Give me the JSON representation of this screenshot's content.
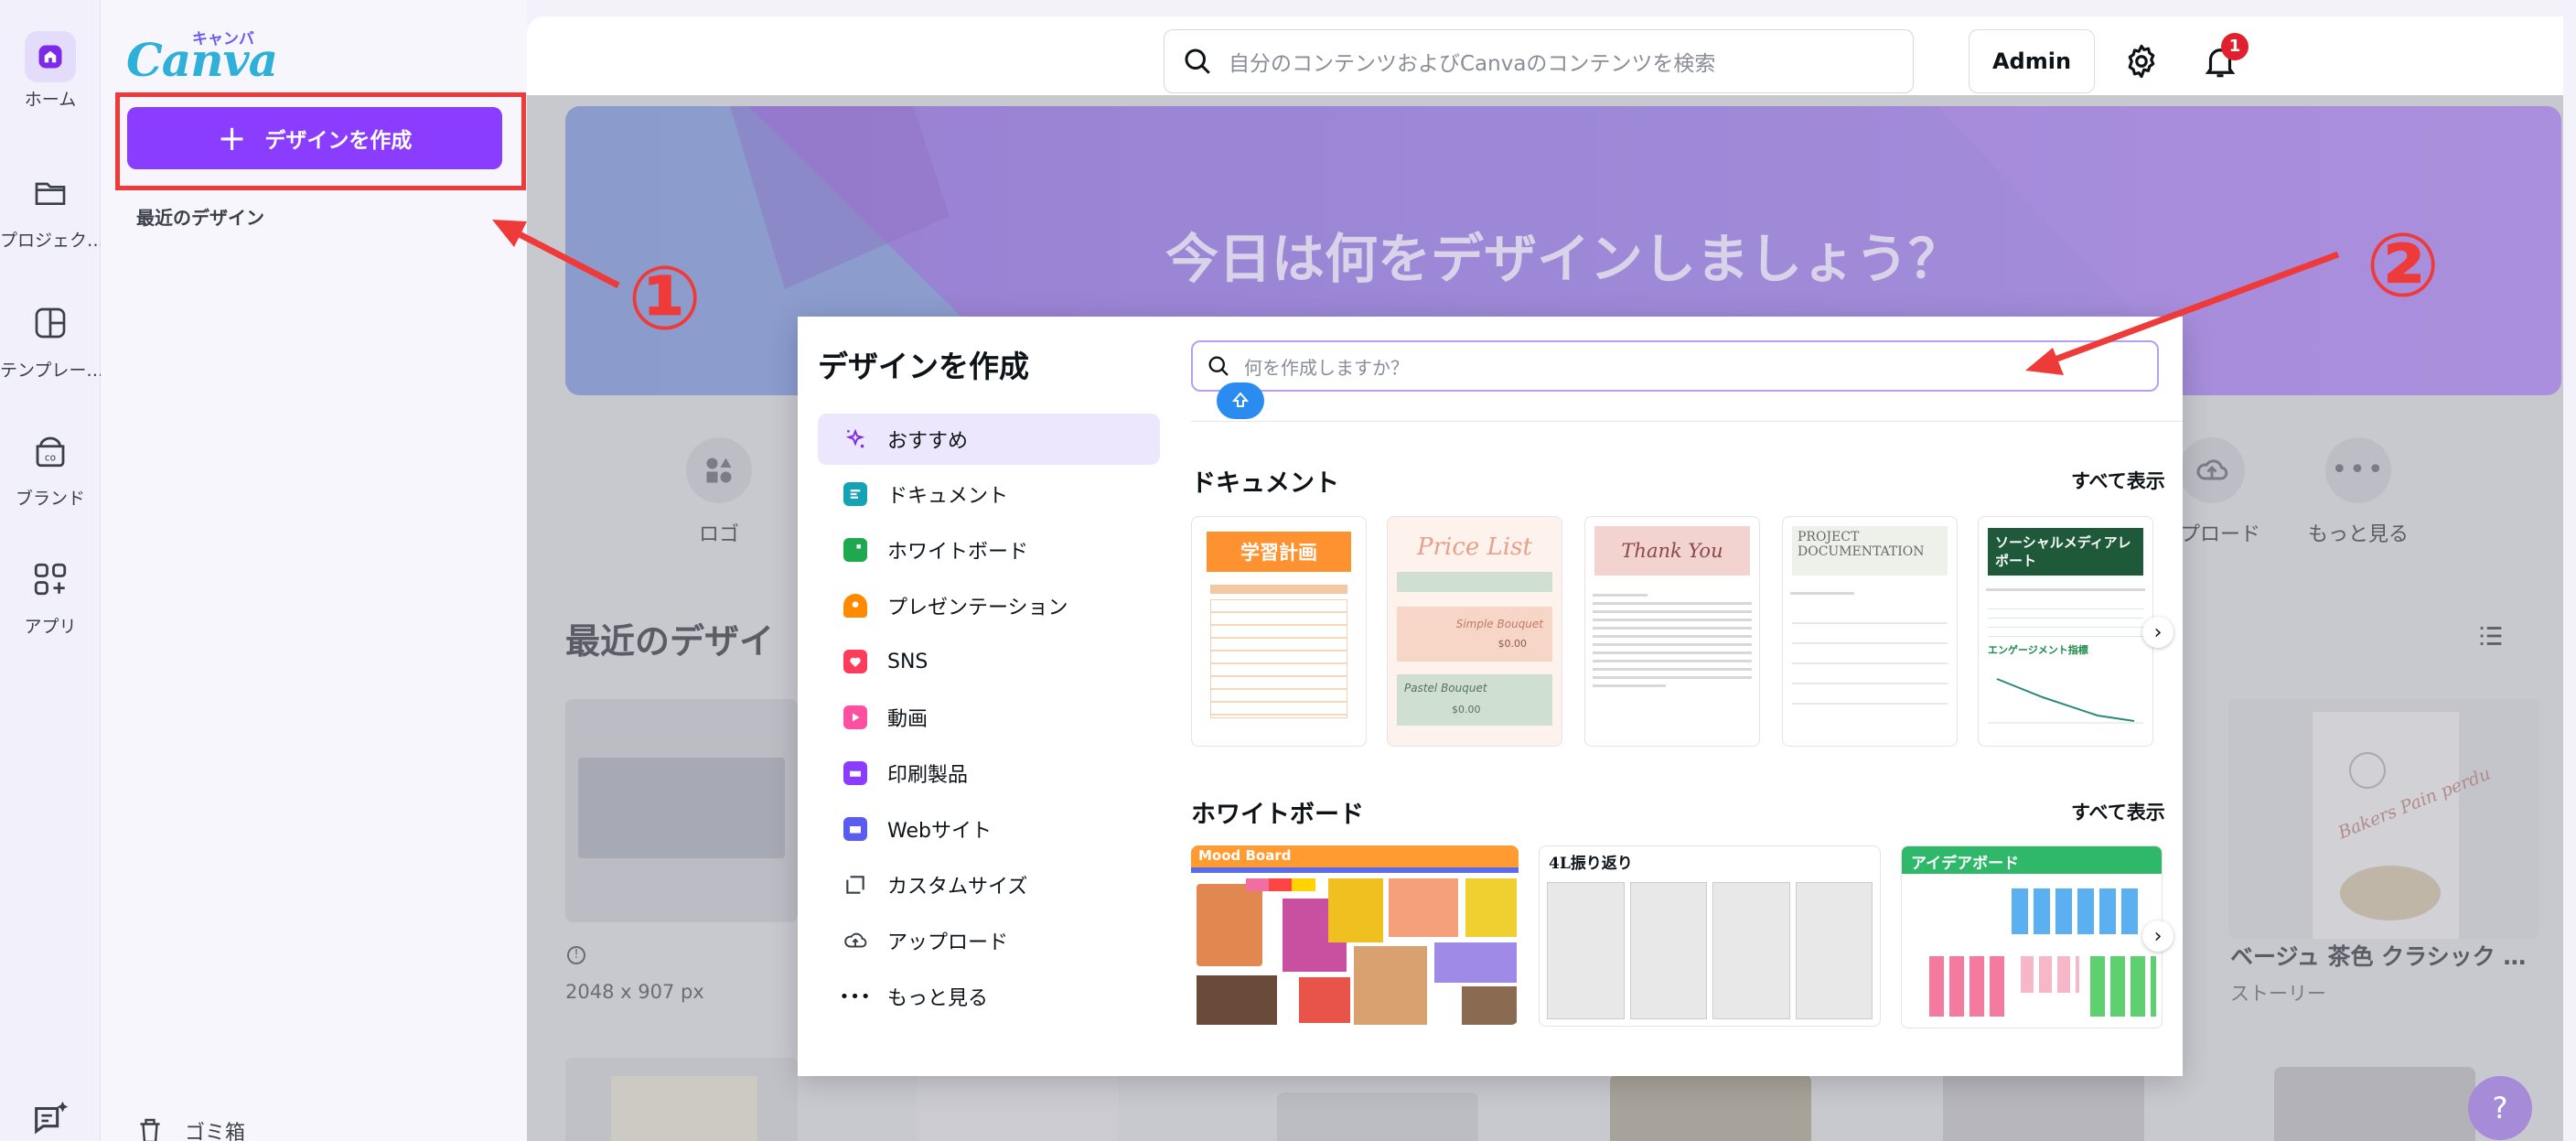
{
  "rail": {
    "items": [
      {
        "label": "ホーム",
        "icon": "home-icon"
      },
      {
        "label": "プロジェク…",
        "icon": "folder-icon"
      },
      {
        "label": "テンプレー…",
        "icon": "template-icon"
      },
      {
        "label": "ブランド",
        "icon": "brand-icon"
      },
      {
        "label": "アプリ",
        "icon": "apps-icon"
      }
    ]
  },
  "logo": {
    "text": "Canva",
    "sub": "キャンバ"
  },
  "left_panel": {
    "create_button": "デザインを作成",
    "recent_label": "最近のデザイン",
    "trash_label": "ゴミ箱"
  },
  "header": {
    "search_placeholder": "自分のコンテンツおよびCanvaのコンテンツを検索",
    "admin_label": "Admin",
    "notification_count": "1"
  },
  "hero": {
    "title": "今日は何をデザインしましょう？"
  },
  "shortcuts": [
    {
      "label": "ロゴ"
    },
    {
      "label": "ップロード"
    },
    {
      "label": "もっと見る"
    }
  ],
  "recent": {
    "heading": "最近のデザイ",
    "card1_size": "2048 x 907 px",
    "card2_title": "ベージュ 茶色 クラシック …",
    "card2_type": "ストーリー",
    "card2_script": "Bakers Pain perdu"
  },
  "help_label": "?",
  "modal": {
    "title": "デザインを作成",
    "search_placeholder": "何を作成しますか？",
    "categories": [
      {
        "label": "おすすめ",
        "icon": "sparkle-icon",
        "color": "#7d2ae8"
      },
      {
        "label": "ドキュメント",
        "icon": "document-icon",
        "color": "#13a3b5"
      },
      {
        "label": "ホワイトボード",
        "icon": "whiteboard-icon",
        "color": "#1ea84f"
      },
      {
        "label": "プレゼンテーション",
        "icon": "presentation-icon",
        "color": "#ff8a00"
      },
      {
        "label": "SNS",
        "icon": "heart-icon",
        "color": "#ff3b5c"
      },
      {
        "label": "動画",
        "icon": "video-icon",
        "color": "#ff4fa0"
      },
      {
        "label": "印刷製品",
        "icon": "print-icon",
        "color": "#8b3dff"
      },
      {
        "label": "Webサイト",
        "icon": "website-icon",
        "color": "#5a5bf0"
      },
      {
        "label": "カスタムサイズ",
        "icon": "custom-size-icon",
        "color": "#3b3f47"
      },
      {
        "label": "アップロード",
        "icon": "upload-icon",
        "color": "#3b3f47"
      },
      {
        "label": "もっと見る",
        "icon": "more-icon",
        "color": "#3b3f47"
      }
    ],
    "documents": {
      "title": "ドキュメント",
      "see_all": "すべて表示",
      "templates": [
        {
          "heading": "学習計画"
        },
        {
          "heading": "Price List",
          "item1": "Simple Bouquet",
          "price1": "$0.00",
          "item2": "Pastel Bouquet",
          "price2": "$0.00"
        },
        {
          "heading": "Thank You"
        },
        {
          "heading": "PROJECT DOCUMENTATION"
        },
        {
          "heading": "ソーシャルメディアレポート",
          "sub": "エンゲージメント指標"
        }
      ]
    },
    "whiteboards": {
      "title": "ホワイトボード",
      "see_all": "すべて表示",
      "templates": [
        {
          "heading": "Mood Board"
        },
        {
          "heading": "4L振り返り"
        },
        {
          "heading": "アイデアボード"
        }
      ]
    }
  },
  "annotations": {
    "one": "①",
    "two": "②"
  },
  "colors": {
    "brand": "#8b3dff",
    "annotation": "#ef3a3a"
  }
}
